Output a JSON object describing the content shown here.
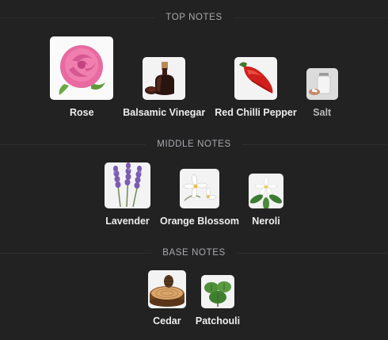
{
  "sections": [
    {
      "title": "TOP NOTES",
      "notes": [
        {
          "label": "Rose",
          "icon": "rose-icon"
        },
        {
          "label": "Balsamic Vinegar",
          "icon": "balsamic-vinegar-icon"
        },
        {
          "label": "Red Chilli Pepper",
          "icon": "red-chilli-pepper-icon"
        },
        {
          "label": "Salt",
          "icon": "salt-icon"
        }
      ]
    },
    {
      "title": "MIDDLE NOTES",
      "notes": [
        {
          "label": "Lavender",
          "icon": "lavender-icon"
        },
        {
          "label": "Orange Blossom",
          "icon": "orange-blossom-icon"
        },
        {
          "label": "Neroli",
          "icon": "neroli-icon"
        }
      ]
    },
    {
      "title": "BASE NOTES",
      "notes": [
        {
          "label": "Cedar",
          "icon": "cedar-icon"
        },
        {
          "label": "Patchouli",
          "icon": "patchouli-icon"
        }
      ]
    }
  ],
  "colors": {
    "background": "#232223",
    "header_text": "#a9a8ad",
    "label_text": "#ececec"
  }
}
